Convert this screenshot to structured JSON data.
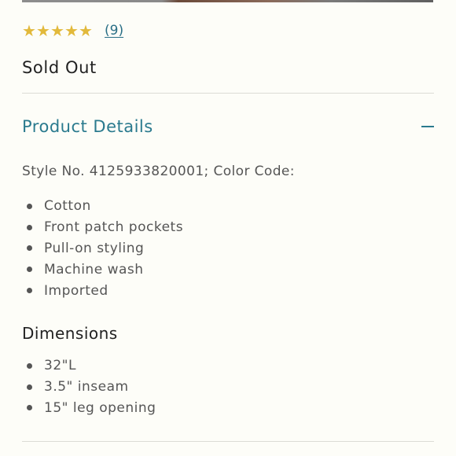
{
  "rating": {
    "stars": [
      "★",
      "★",
      "★",
      "★",
      "★"
    ],
    "value": 5,
    "review_count": "(9)",
    "star_color": "#e2b93b"
  },
  "availability": "Sold Out",
  "product_details": {
    "title": "Product Details",
    "expanded": true,
    "accent_color": "#2a7a8e",
    "style_line": "Style No. 4125933820001; Color Code:",
    "features": [
      "Cotton",
      "Front patch pockets",
      "Pull-on styling",
      "Machine wash",
      "Imported"
    ],
    "dimensions_title": "Dimensions",
    "dimensions": [
      "32\"L",
      "3.5\" inseam",
      "15\" leg opening"
    ]
  }
}
